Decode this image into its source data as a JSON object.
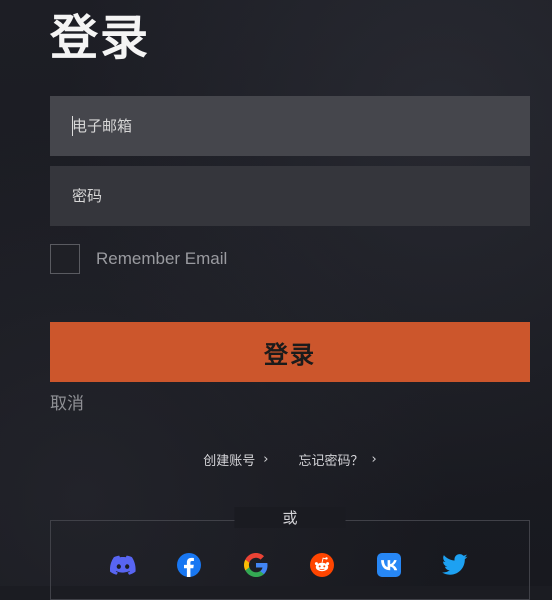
{
  "page": {
    "title": "登录"
  },
  "form": {
    "email_placeholder": "电子邮箱",
    "password_placeholder": "密码",
    "remember_label": "Remember Email",
    "login_label": "登录",
    "cancel_label": "取消"
  },
  "links": {
    "create_account": "创建账号",
    "forgot_password": "忘记密码？",
    "chevron": "›"
  },
  "divider": {
    "or_label": "或"
  },
  "socials": [
    {
      "name": "discord-icon",
      "color": "#5865f2"
    },
    {
      "name": "facebook-icon",
      "color": "#1877f2"
    },
    {
      "name": "google-icon",
      "color": "#4285f4"
    },
    {
      "name": "reddit-icon",
      "color": "#ff4500"
    },
    {
      "name": "vk-icon",
      "color": "#2787f5"
    },
    {
      "name": "twitter-icon",
      "color": "#1da1f2"
    }
  ],
  "colors": {
    "accent": "#cc562c",
    "background": "#1b1c22"
  }
}
